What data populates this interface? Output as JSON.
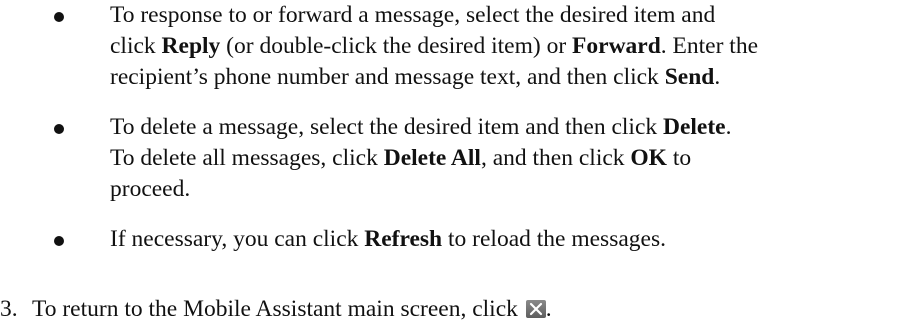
{
  "bullets": [
    {
      "line1_a": "To response to or forward a message, select the desired item and",
      "line2_a": "click ",
      "line2_b": "Reply",
      "line2_c": " (or double-click the desired item) or ",
      "line2_d": "Forward",
      "line2_e": ". Enter the",
      "line3_a": "recipient’s phone number and message text, and then click ",
      "line3_b": "Send",
      "line3_c": "."
    },
    {
      "line1_a": "To delete a message, select the desired item and then click ",
      "line1_b": "Delete",
      "line1_c": ".",
      "line2_a": "To delete all messages, click ",
      "line2_b": "Delete All",
      "line2_c": ", and then click ",
      "line2_d": "OK",
      "line2_e": " to",
      "line3_a": "proceed."
    },
    {
      "line1_a": "If necessary, you can click ",
      "line1_b": "Refresh",
      "line1_c": " to reload the messages."
    }
  ],
  "step": {
    "number": "3.",
    "text_a": "To return to the Mobile Assistant main screen, click ",
    "text_b": ".",
    "icon": "close-icon"
  }
}
